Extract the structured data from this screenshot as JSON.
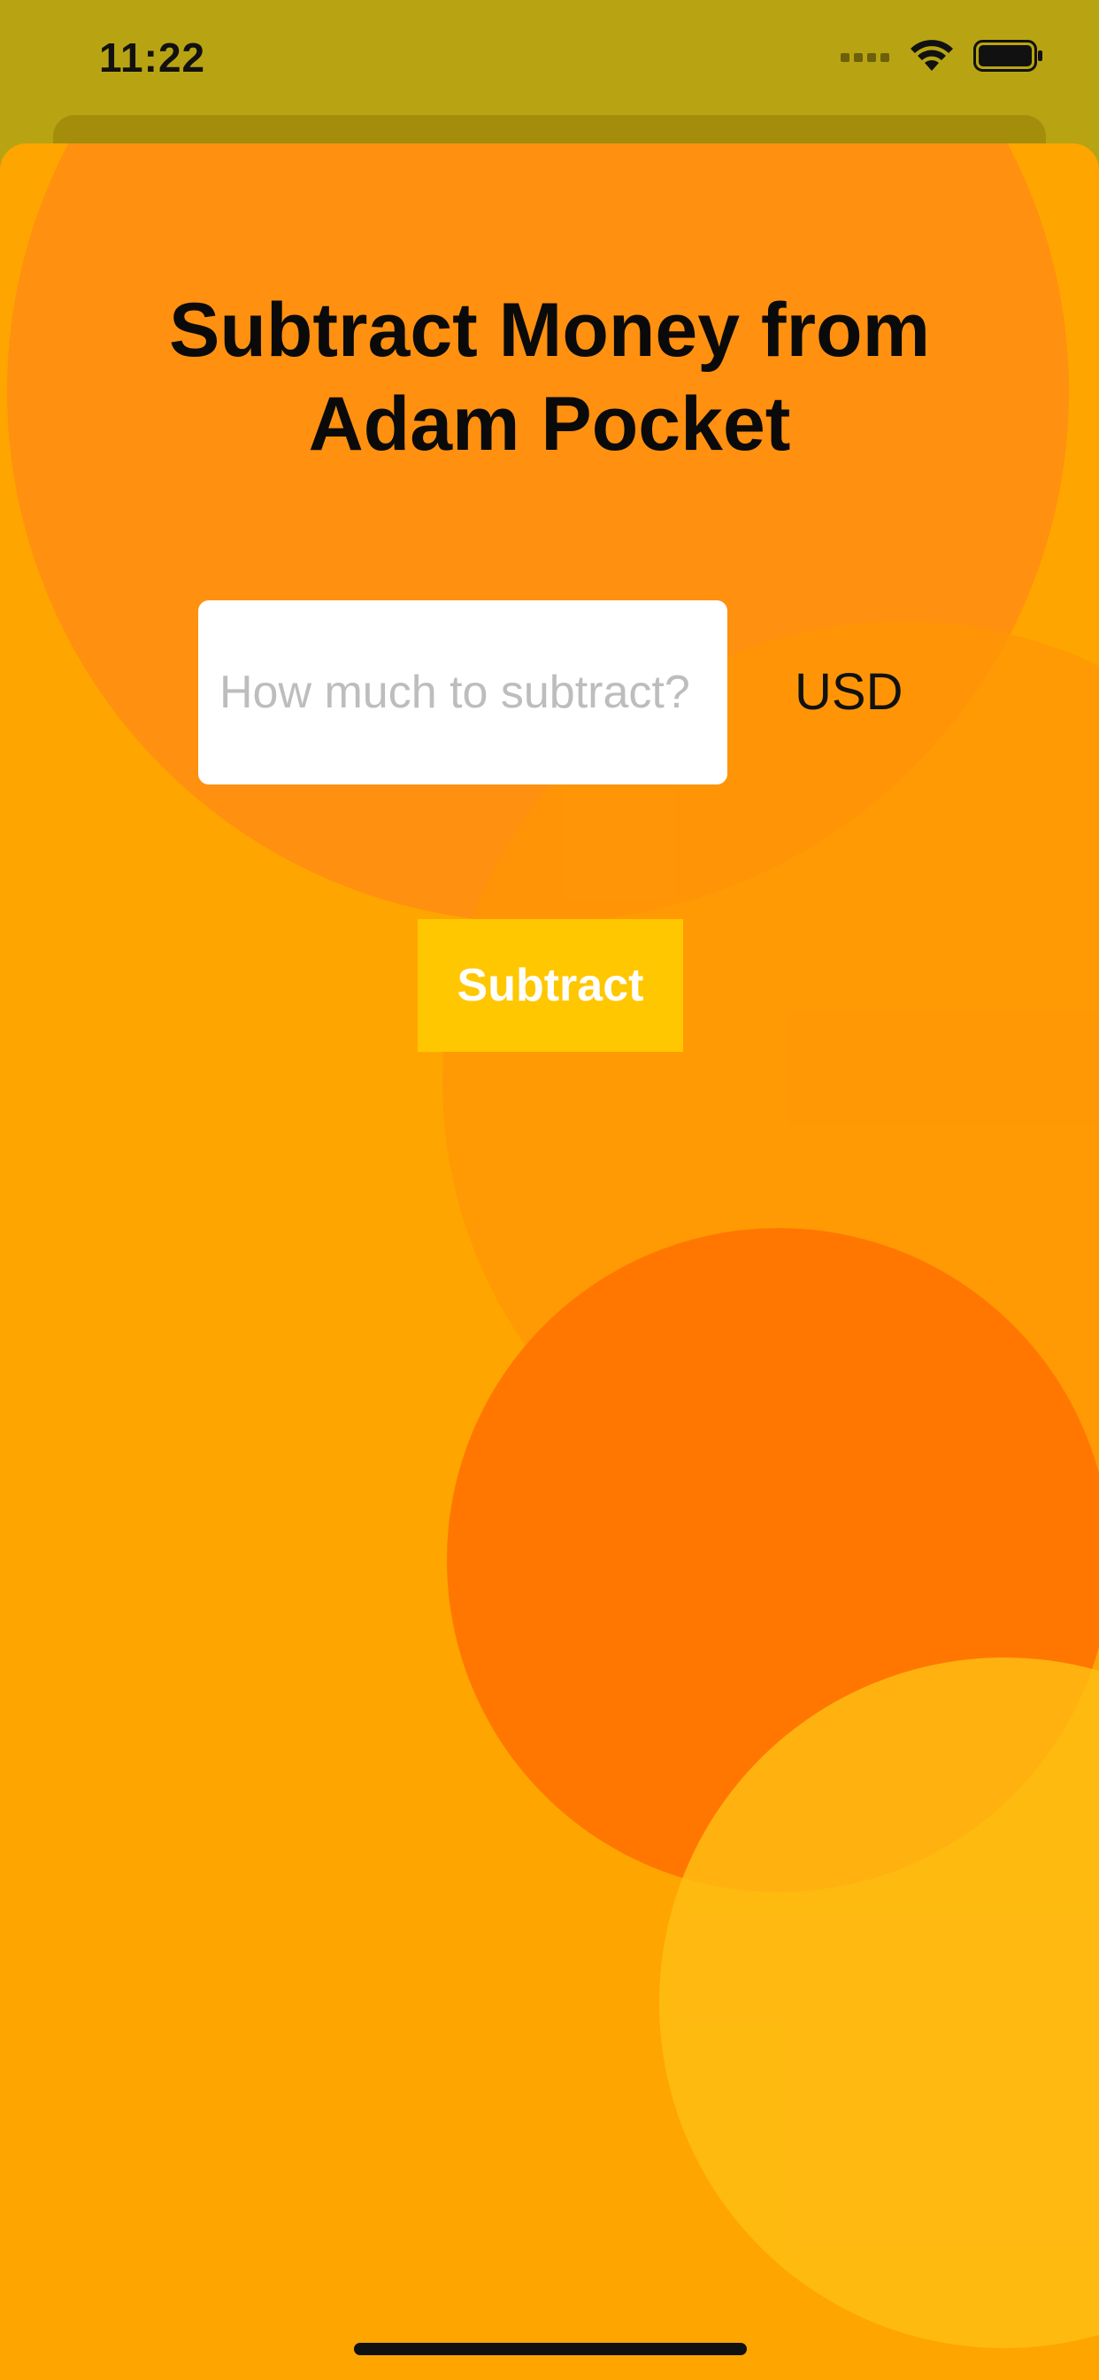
{
  "status_bar": {
    "time": "11:22",
    "icons": [
      "signal-icon",
      "wifi-icon",
      "battery-icon"
    ]
  },
  "main": {
    "title": "Subtract Money from\nAdam  Pocket",
    "amount_input": {
      "value": "",
      "placeholder": "How much to subtract?"
    },
    "currency": "USD",
    "subtract_button_label": "Subtract"
  },
  "colors": {
    "status_background": "#B8A412",
    "sheet_background": "#FFA500",
    "button_background": "#FFC700",
    "button_text": "#FFFFFF",
    "placeholder_text": "#BDBDBD"
  }
}
